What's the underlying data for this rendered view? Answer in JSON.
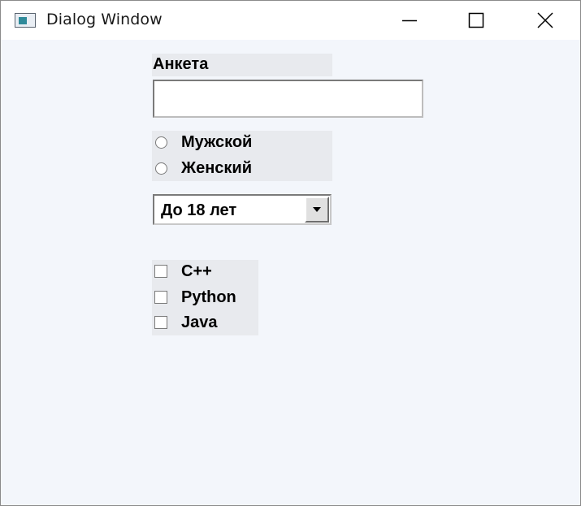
{
  "window": {
    "title": "Dialog Window",
    "app_icon": "window-app-icon",
    "controls": {
      "minimize_icon": "minimize-icon",
      "maximize_icon": "maximize-icon",
      "close_icon": "close-icon"
    }
  },
  "form": {
    "heading": "Анкета",
    "name_input": {
      "value": "",
      "placeholder": ""
    },
    "gender": {
      "options": [
        {
          "label": "Мужской",
          "selected": false
        },
        {
          "label": "Женский",
          "selected": false
        }
      ]
    },
    "age_select": {
      "selected": "До 18 лет",
      "arrow_icon": "dropdown-arrow-icon"
    },
    "languages": {
      "options": [
        {
          "label": "C++",
          "checked": false
        },
        {
          "label": "Python",
          "checked": false
        },
        {
          "label": "Java",
          "checked": false
        }
      ]
    }
  },
  "colors": {
    "client_background": "#f3f6fb",
    "group_background": "#e8eaee",
    "titlebar_background": "#ffffff"
  }
}
